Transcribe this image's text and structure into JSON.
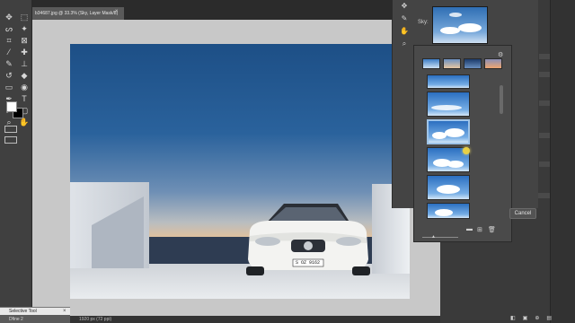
{
  "document": {
    "tab_title": "b34687.jpg @ 33.3% (Sky, Layer Mask/8)",
    "close_symbol": "×"
  },
  "toolbar": {
    "tools": [
      {
        "name": "move-tool-icon",
        "glyph": "✥"
      },
      {
        "name": "marquee-tool-icon",
        "glyph": "⬚"
      },
      {
        "name": "lasso-tool-icon",
        "glyph": "ᔕ"
      },
      {
        "name": "magic-wand-icon",
        "glyph": "✦"
      },
      {
        "name": "crop-tool-icon",
        "glyph": "⌗"
      },
      {
        "name": "frame-tool-icon",
        "glyph": "⊠"
      },
      {
        "name": "eyedropper-icon",
        "glyph": "⁄"
      },
      {
        "name": "healing-brush-icon",
        "glyph": "✚"
      },
      {
        "name": "brush-tool-icon",
        "glyph": "✎"
      },
      {
        "name": "stamp-tool-icon",
        "glyph": "⊥"
      },
      {
        "name": "history-brush-icon",
        "glyph": "↺"
      },
      {
        "name": "eraser-icon",
        "glyph": "◆"
      },
      {
        "name": "gradient-tool-icon",
        "glyph": "▭"
      },
      {
        "name": "blur-tool-icon",
        "glyph": "◉"
      },
      {
        "name": "pen-tool-icon",
        "glyph": "✒"
      },
      {
        "name": "type-tool-icon",
        "glyph": "T"
      },
      {
        "name": "path-selection-icon",
        "glyph": "➤"
      },
      {
        "name": "shape-tool-icon",
        "glyph": "▢"
      },
      {
        "name": "zoom-tool-icon",
        "glyph": "⌕"
      },
      {
        "name": "hand-tool-icon",
        "glyph": "✋"
      }
    ]
  },
  "sky_dialog": {
    "sky_label": "Sky:",
    "tools": [
      {
        "name": "sky-move-tool-icon",
        "glyph": "✥"
      },
      {
        "name": "sky-brush-tool-icon",
        "glyph": "✎"
      },
      {
        "name": "sky-hand-tool-icon",
        "glyph": "✋"
      },
      {
        "name": "sky-zoom-tool-icon",
        "glyph": "⌕"
      }
    ],
    "gear_glyph": "⚙",
    "cancel_label": "Cancel"
  },
  "picker": {
    "footer_icons": [
      {
        "name": "new-group-icon",
        "glyph": "▬"
      },
      {
        "name": "add-sky-icon",
        "glyph": "⊞"
      },
      {
        "name": "delete-sky-icon",
        "glyph": "🗑"
      }
    ],
    "slider_glyph": "▲"
  },
  "photo": {
    "license_plate": "S OZ 9162"
  },
  "status_bar": {
    "zoom_text": "33.33%",
    "doc_info": "1920 px (72 ppi)"
  },
  "selective_tool": {
    "title": "Selective Tool",
    "subtitle": "Dfine 2",
    "close_symbol": "×"
  },
  "bottom_icons": [
    "◧",
    "▣",
    "⊕",
    "▤"
  ]
}
